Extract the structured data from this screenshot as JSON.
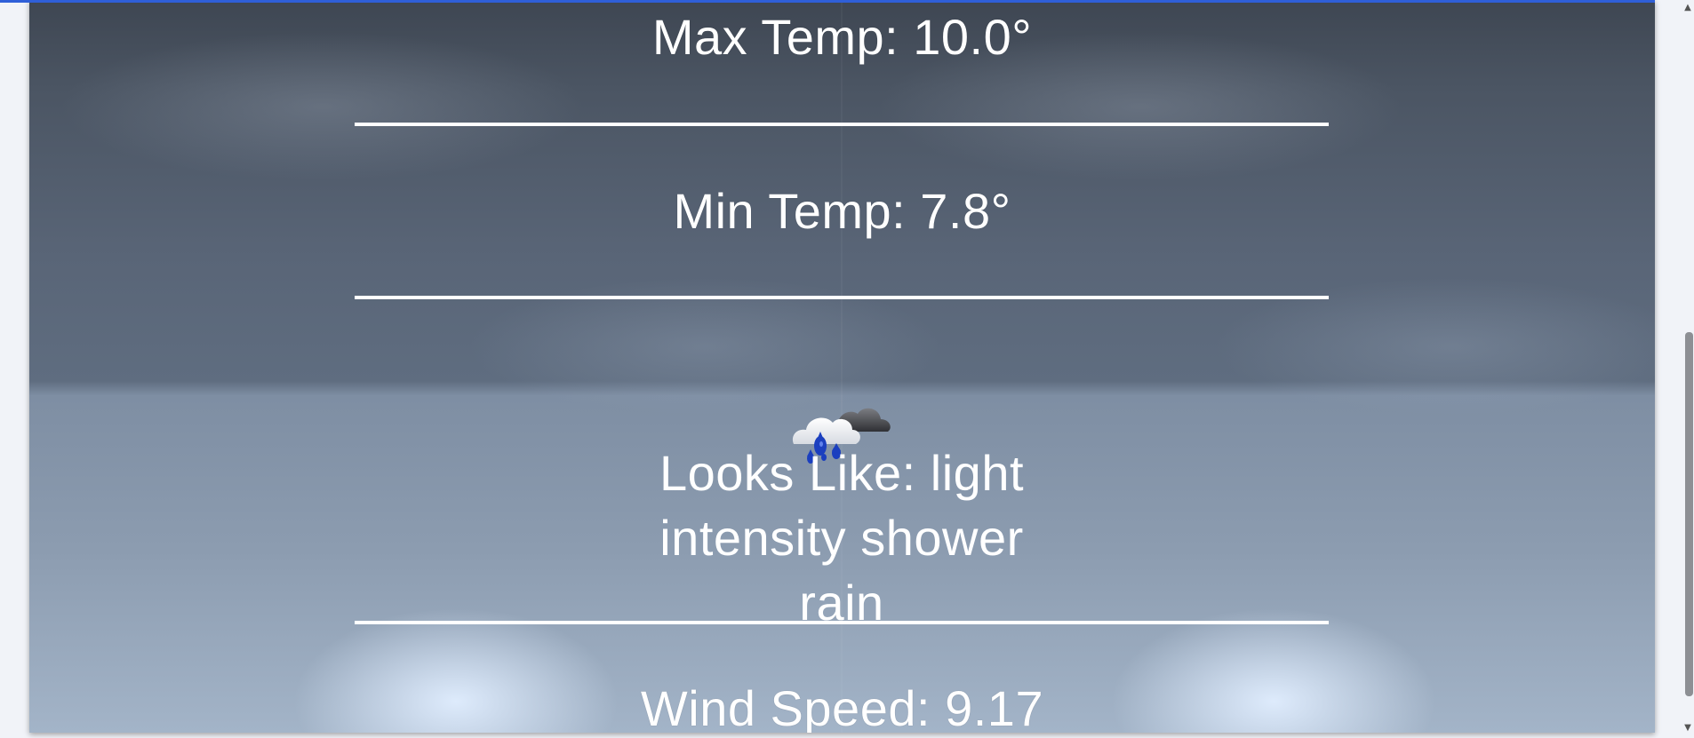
{
  "weather": {
    "max_temp": "Max Temp: 10.0°",
    "min_temp": "Min Temp: 7.8°",
    "looks_like": "Looks Like: light intensity shower rain",
    "wind_speed": "Wind Speed: 9.17",
    "icon": "rain-shower-cloud-icon"
  },
  "colors": {
    "accent": "#2f5fd8",
    "text": "#ffffff",
    "divider": "#ffffff",
    "rain": "#1b3fbf"
  },
  "scrollbar": {
    "up_arrow": "▲",
    "down_arrow": "▼"
  }
}
